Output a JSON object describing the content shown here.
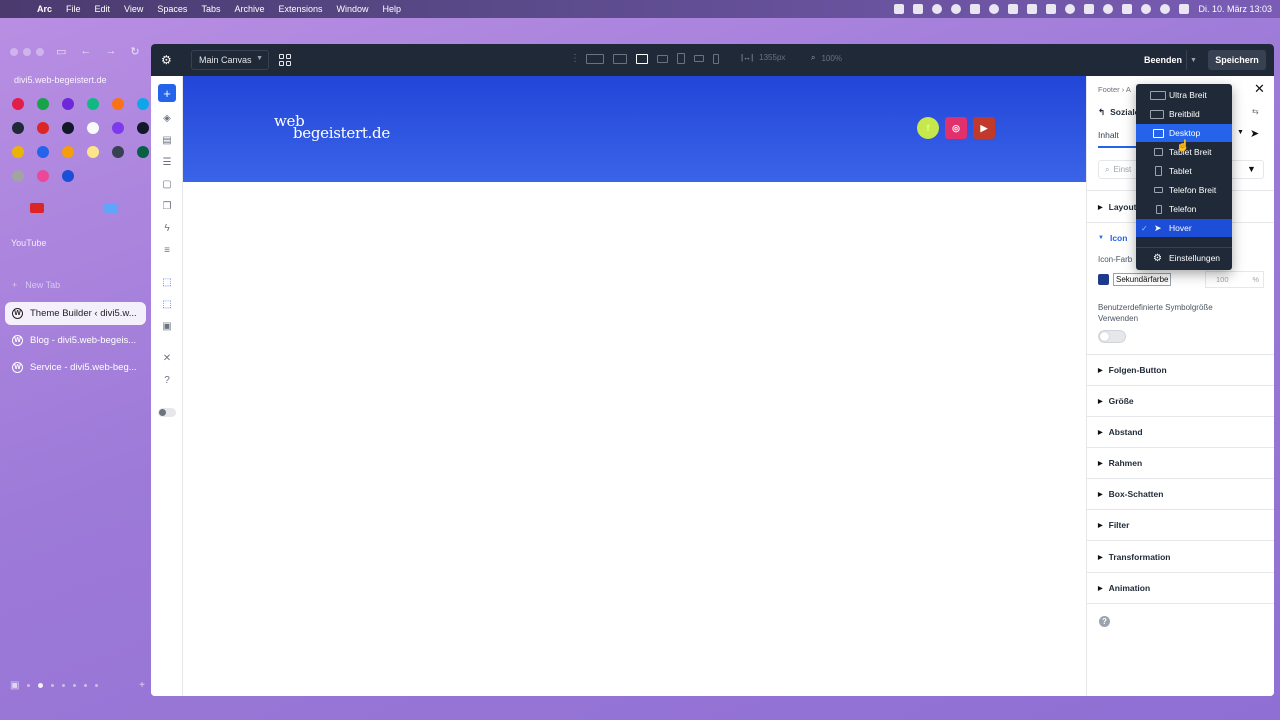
{
  "menubar": {
    "app": "Arc",
    "items": [
      "File",
      "Edit",
      "View",
      "Spaces",
      "Tabs",
      "Archive",
      "Extensions",
      "Window",
      "Help"
    ],
    "clock": "Di. 10. März  13:03"
  },
  "sidebar": {
    "url": "divi5.web-begeistert.de",
    "folder_label": "YouTube",
    "new_tab": "New Tab",
    "tabs": [
      {
        "label": "Theme Builder ‹ divi5.w...",
        "active": true
      },
      {
        "label": "Blog - divi5.web-begeis...",
        "active": false
      },
      {
        "label": "Service - divi5.web-beg...",
        "active": false
      }
    ]
  },
  "toolbar": {
    "canvas_select": "Main Canvas",
    "width_value": "1355px",
    "zoom_value": "100%",
    "exit_label": "Beenden",
    "save_label": "Speichern"
  },
  "canvas": {
    "logo_line1": "web",
    "logo_line2": "begeistert.de",
    "social": [
      {
        "name": "facebook",
        "glyph": "f",
        "color": "#c7e84c"
      },
      {
        "name": "instagram",
        "glyph": "◎",
        "color": "#e1306c"
      },
      {
        "name": "youtube",
        "glyph": "▶",
        "color": "#c0392b"
      }
    ]
  },
  "panel": {
    "breadcrumb": "Footer  ›  A",
    "module_title": "Soziale",
    "tabs": [
      "Inhalt",
      "D"
    ],
    "search_placeholder": "Einst",
    "sections": {
      "layout": "Layout",
      "icon": "Icon",
      "follow_button": "Folgen-Button",
      "size": "Größe",
      "spacing": "Abstand",
      "border": "Rahmen",
      "box_shadow": "Box-Schatten",
      "filter": "Filter",
      "transform": "Transformation",
      "animation": "Animation"
    },
    "icon_color_label": "Icon-Farb",
    "icon_color_value": "Sekundärfarbe",
    "icon_color_swatch": "#1e3a8a",
    "opacity_value": "100",
    "opacity_unit": "%",
    "custom_size_label": "Benutzerdefinierte Symbolgröße Verwenden"
  },
  "breakpoint_menu": {
    "items": [
      "Ultra Breit",
      "Breitbild",
      "Desktop",
      "Tablet Breit",
      "Tablet",
      "Telefon Breit",
      "Telefon",
      "Hover"
    ],
    "selected": "Desktop",
    "checked": "Hover",
    "settings": "Einstellungen"
  },
  "colors": {
    "accent": "#2563eb",
    "toolbar_bg": "#1f2937",
    "hero_blue": "#2245d8"
  }
}
